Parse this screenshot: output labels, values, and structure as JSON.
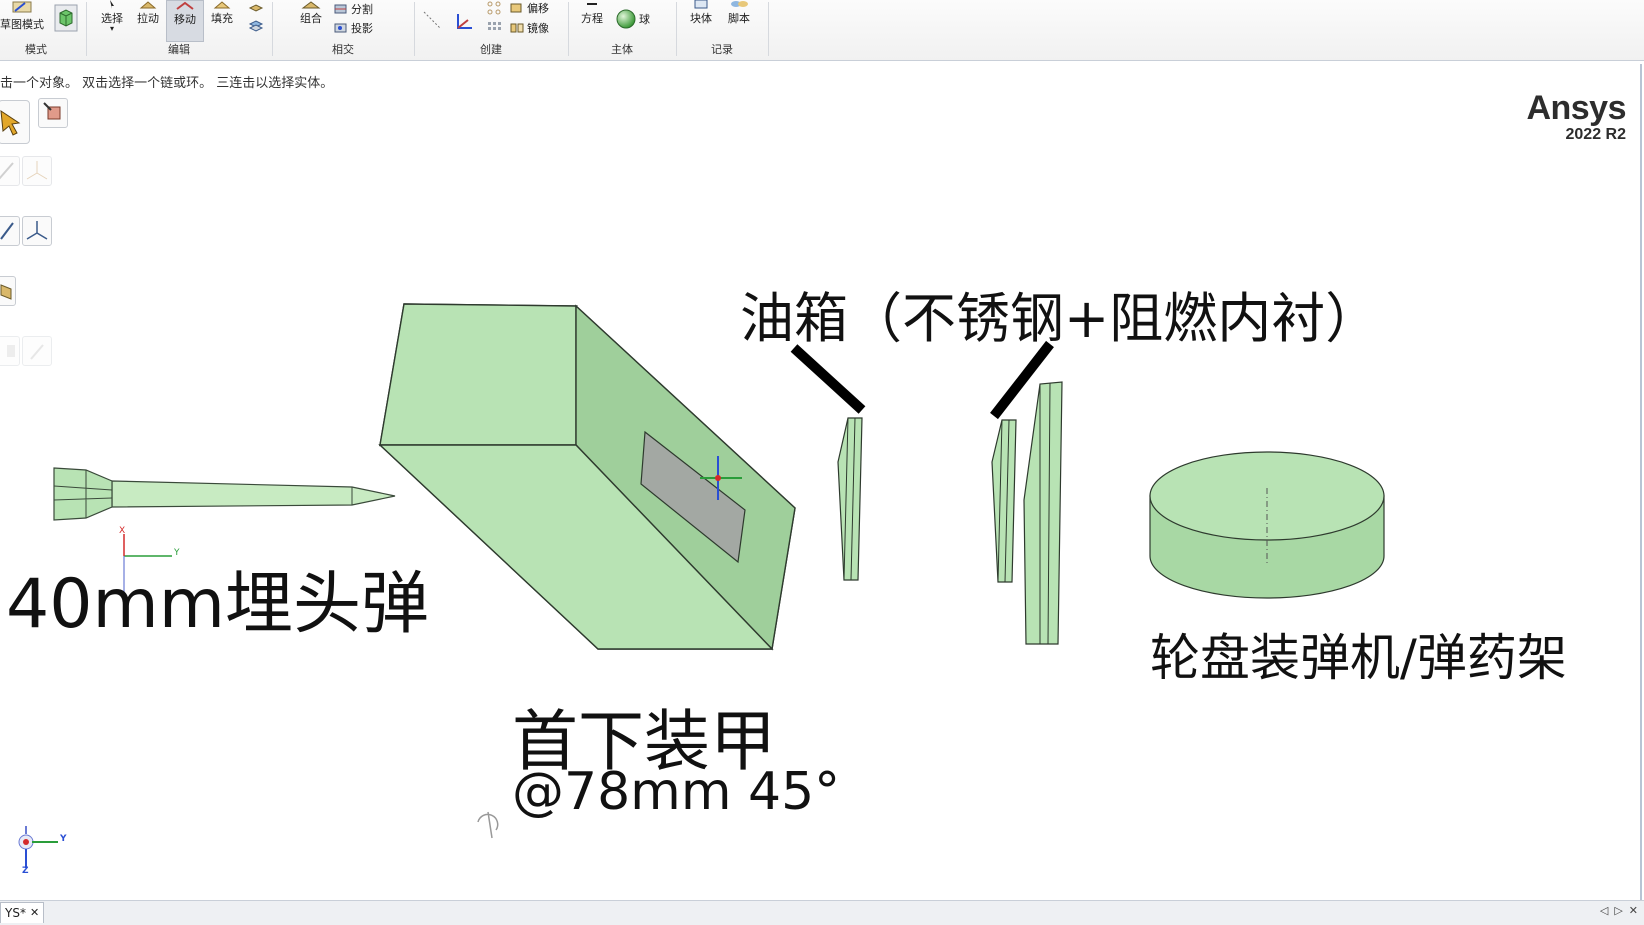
{
  "ribbon": {
    "groups": {
      "mode": {
        "label": "模式",
        "sketch_mode": "草图模式"
      },
      "edit": {
        "label": "编辑",
        "select": "选择",
        "pull": "拉动",
        "move": "移动",
        "fill": "填充"
      },
      "intersect": {
        "label": "相交",
        "combine": "组合",
        "split": "分割",
        "project": "投影"
      },
      "create": {
        "label": "创建",
        "offset": "偏移",
        "mirror": "镜像"
      },
      "body": {
        "label": "主体",
        "equation": "方程",
        "sphere": "球"
      },
      "record": {
        "label": "记录",
        "block": "块体",
        "script": "脚本"
      }
    }
  },
  "status_hint": "击一个对象。 双击选择一个链或环。 三连击以选择实体。",
  "logo": {
    "brand": "Ansys",
    "version": "2022 R2"
  },
  "scene": {
    "labels": {
      "projectile": "40mm埋头弹",
      "armor_title": "首下装甲",
      "armor_spec": "@78mm 45°",
      "tank": "油箱（不锈钢+阻燃内衬）",
      "autoloader": "轮盘装弹机/弹药架"
    },
    "triad": {
      "y": "Y",
      "x": "X",
      "z": "Z"
    }
  },
  "tabs": [
    {
      "label": "YS*"
    }
  ],
  "colors": {
    "body_fill": "#b8e3b4",
    "body_side": "#9fcf9b",
    "edge": "#2e3a2e",
    "accent_axis_y": "#2a9d3a",
    "accent_axis_x": "#d42a2a",
    "accent_axis_z": "#2a4fd4"
  }
}
